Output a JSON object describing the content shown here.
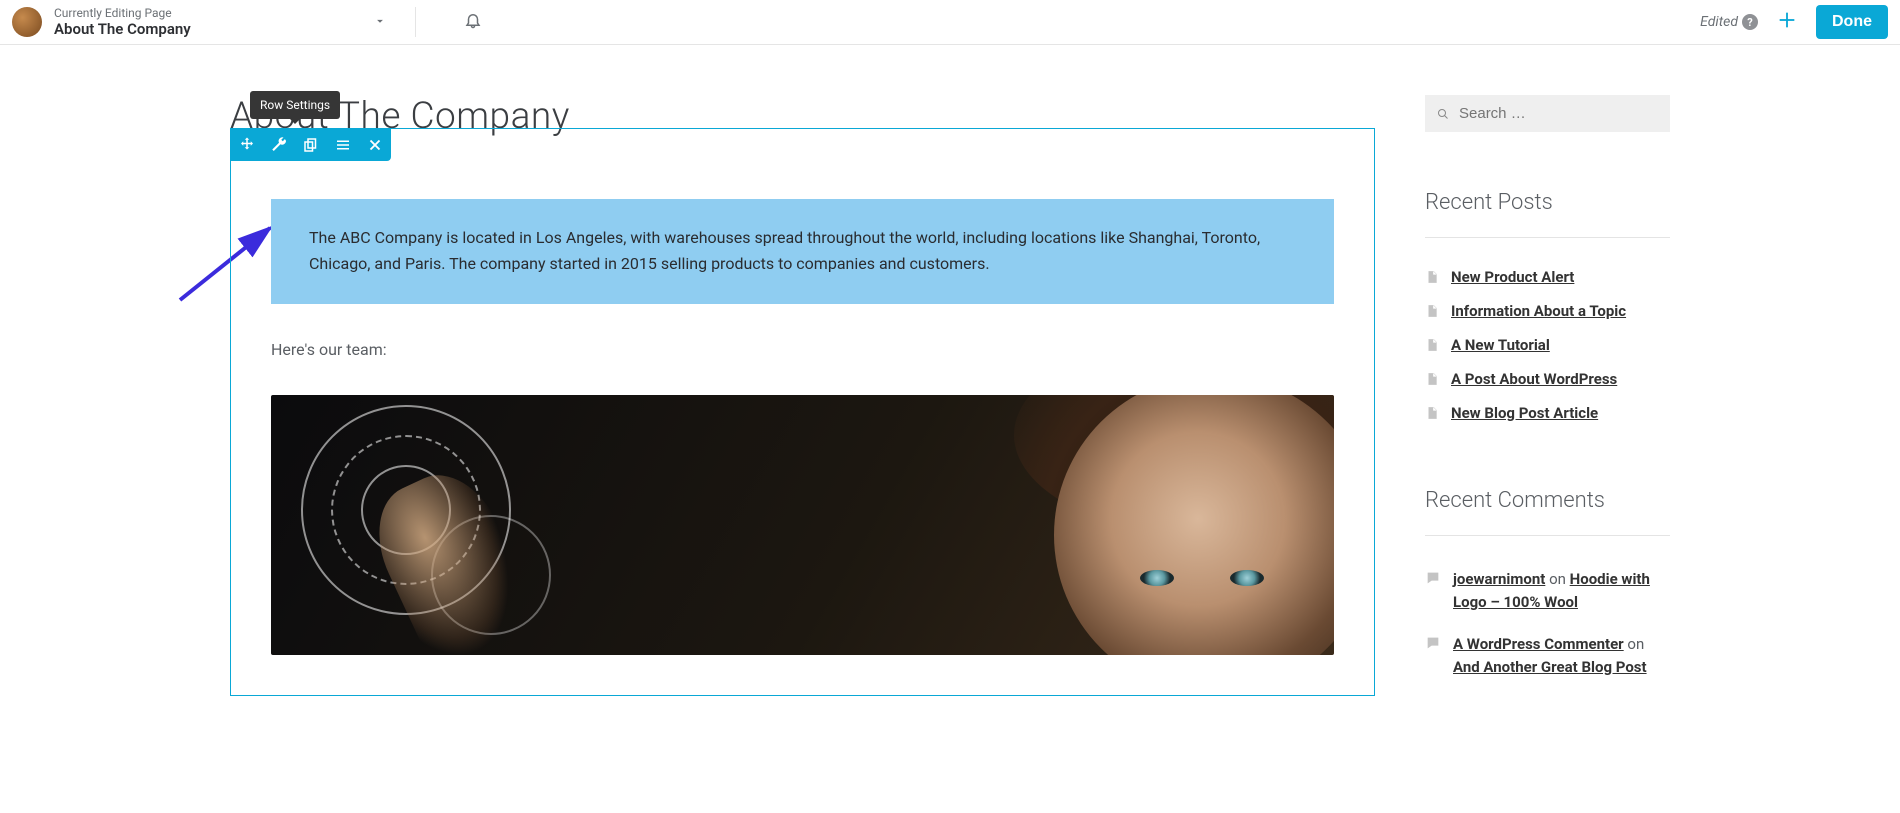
{
  "header": {
    "subtitle": "Currently Editing Page",
    "title": "About The Company",
    "edited_label": "Edited",
    "done_label": "Done"
  },
  "page": {
    "heading": "About The Company",
    "tooltip": "Row Settings",
    "callout_text": "The ABC Company is located in Los Angeles, with warehouses spread throughout the world, including locations like Shanghai, Toronto, Chicago, and Paris. The company started in 2015 selling products to companies and customers.",
    "team_label": "Here's our team:"
  },
  "sidebar": {
    "search_placeholder": "Search …",
    "recent_posts_title": "Recent Posts",
    "posts": [
      {
        "label": "New Product Alert"
      },
      {
        "label": "Information About a Topic"
      },
      {
        "label": "A New Tutorial"
      },
      {
        "label": "A Post About WordPress"
      },
      {
        "label": "New Blog Post Article"
      }
    ],
    "recent_comments_title": "Recent Comments",
    "comments": [
      {
        "author": "joewarnimont",
        "on": "on",
        "post": "Hoodie with Logo – 100% Wool"
      },
      {
        "author": "A WordPress Commenter",
        "on": "on",
        "post": "And Another Great Blog Post"
      }
    ]
  }
}
